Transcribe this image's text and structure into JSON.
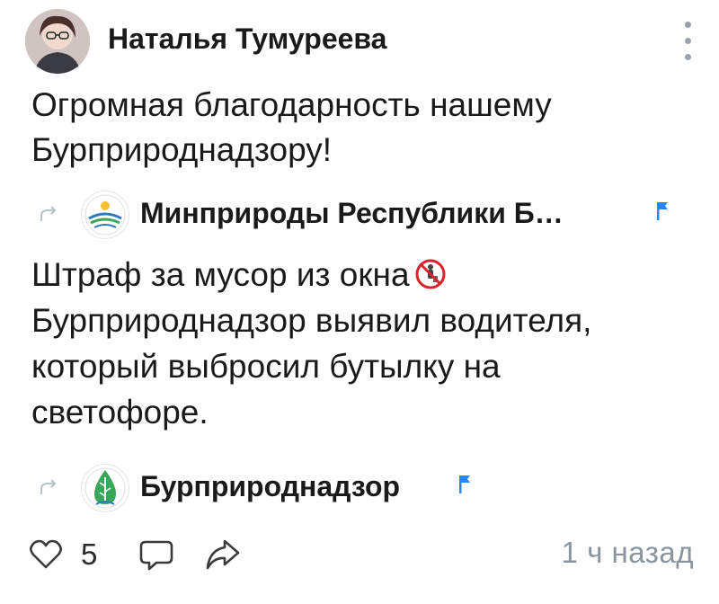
{
  "post": {
    "author_name": "Наталья Тумуреева",
    "text_line1": "Огромная благодарность нашему",
    "text_line2": "Бурприроднадзору!"
  },
  "repost1": {
    "source_name": "Минприроды Республики Б…",
    "text_line1": "Штраф за мусор из окна",
    "text_line2": "Бурприроднадзор выявил водителя,",
    "text_line3": "который выбросил бутылку на",
    "text_line4": "светофоре."
  },
  "repost2": {
    "source_name": "Бурприроднадзор"
  },
  "footer": {
    "likes": "5",
    "timestamp": "1 ч назад"
  },
  "colors": {
    "text": "#1a1a1a",
    "muted": "#8a949e",
    "verified_flag": "#2787f5",
    "eco_green": "#3aa65a"
  },
  "icons": {
    "more": "more-vertical-icon",
    "repost": "repost-arrow-icon",
    "flag": "verified-flag-icon",
    "like": "heart-icon",
    "comment": "comment-icon",
    "share": "share-icon",
    "no_litter": "no-littering-emoji"
  }
}
